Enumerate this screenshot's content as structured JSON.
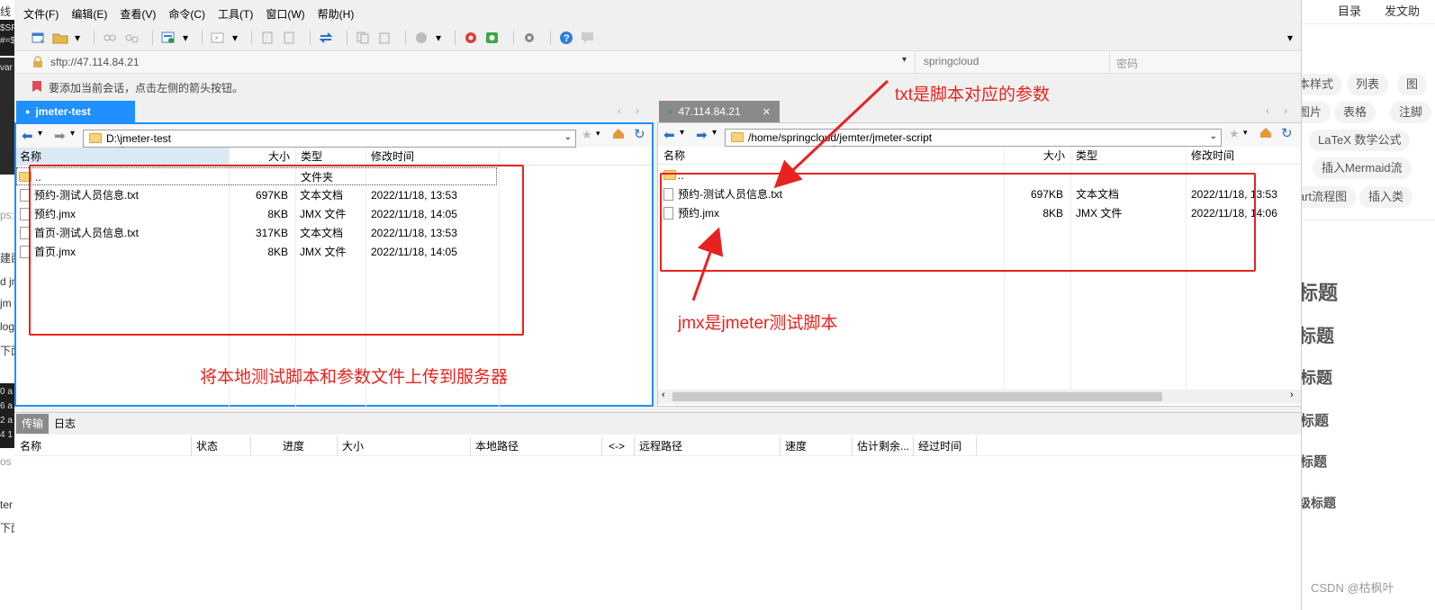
{
  "menu": [
    "文件(F)",
    "编辑(E)",
    "查看(V)",
    "命令(C)",
    "工具(T)",
    "窗口(W)",
    "帮助(H)"
  ],
  "address": {
    "url": "sftp://47.114.84.21",
    "user": "springcloud",
    "password_placeholder": "密码"
  },
  "infobar": "要添加当前会话，点击左侧的箭头按钮。",
  "left_pane": {
    "tab": "jmeter-test",
    "path": "D:\\jmeter-test",
    "columns": {
      "name": "名称",
      "size": "大小",
      "type": "类型",
      "mtime": "修改时间"
    },
    "parent": {
      "name": "..",
      "type": "文件夹"
    },
    "files": [
      {
        "name": "预约-测试人员信息.txt",
        "size": "697KB",
        "type": "文本文档",
        "mtime": "2022/11/18, 13:53",
        "icon": "text-file-icon"
      },
      {
        "name": "预约.jmx",
        "size": "8KB",
        "type": "JMX 文件",
        "mtime": "2022/11/18, 14:05",
        "icon": "file-icon"
      },
      {
        "name": "首页-测试人员信息.txt",
        "size": "317KB",
        "type": "文本文档",
        "mtime": "2022/11/18, 13:53",
        "icon": "text-file-icon"
      },
      {
        "name": "首页.jmx",
        "size": "8KB",
        "type": "JMX 文件",
        "mtime": "2022/11/18, 14:05",
        "icon": "file-icon"
      }
    ]
  },
  "right_pane": {
    "tab": "47.114.84.21",
    "path": "/home/springcloud/jemter/jmeter-script",
    "columns": {
      "name": "名称",
      "size": "大小",
      "type": "类型",
      "mtime": "修改时间"
    },
    "parent": {
      "name": ".."
    },
    "files": [
      {
        "name": "预约-测试人员信息.txt",
        "size": "697KB",
        "type": "文本文档",
        "mtime": "2022/11/18, 13:53",
        "icon": "text-file-icon"
      },
      {
        "name": "预约.jmx",
        "size": "8KB",
        "type": "JMX 文件",
        "mtime": "2022/11/18, 14:06",
        "icon": "file-icon"
      }
    ]
  },
  "bottom": {
    "tabs": [
      "传输",
      "日志"
    ],
    "columns": [
      "名称",
      "状态",
      "进度",
      "大小",
      "本地路径",
      "<->",
      "远程路径",
      "速度",
      "估计剩余...",
      "经过时间"
    ]
  },
  "annotations": {
    "txt": "txt是脚本对应的参数",
    "jmx": "jmx是jmeter测试脚本",
    "upload": "将本地测试脚本和参数文件上传到服务器"
  },
  "right_bg": {
    "links": [
      "目录",
      "发文助"
    ],
    "chips": [
      "本样式",
      "列表",
      "图",
      "图片",
      "表格",
      "注脚",
      "LaTeX 数学公式",
      "插入Mermaid流",
      "art流程图",
      "插入类"
    ],
    "headings": [
      "标题",
      "标题",
      "标题",
      "标题",
      "标题",
      "级标题"
    ],
    "watermark": "CSDN @枯枫叶"
  },
  "left_bg_fragments": [
    "线",
    "$SP",
    "#=$",
    "var",
    "ps:",
    "建西",
    "d jn",
    "jm",
    "log",
    "下面",
    "0 a",
    "6 a",
    "2 a",
    "4 1",
    "os",
    "ter",
    "下面"
  ],
  "colors": {
    "accent": "#1e90ff",
    "annotation": "#e8231f",
    "connected": "#22b14c"
  }
}
